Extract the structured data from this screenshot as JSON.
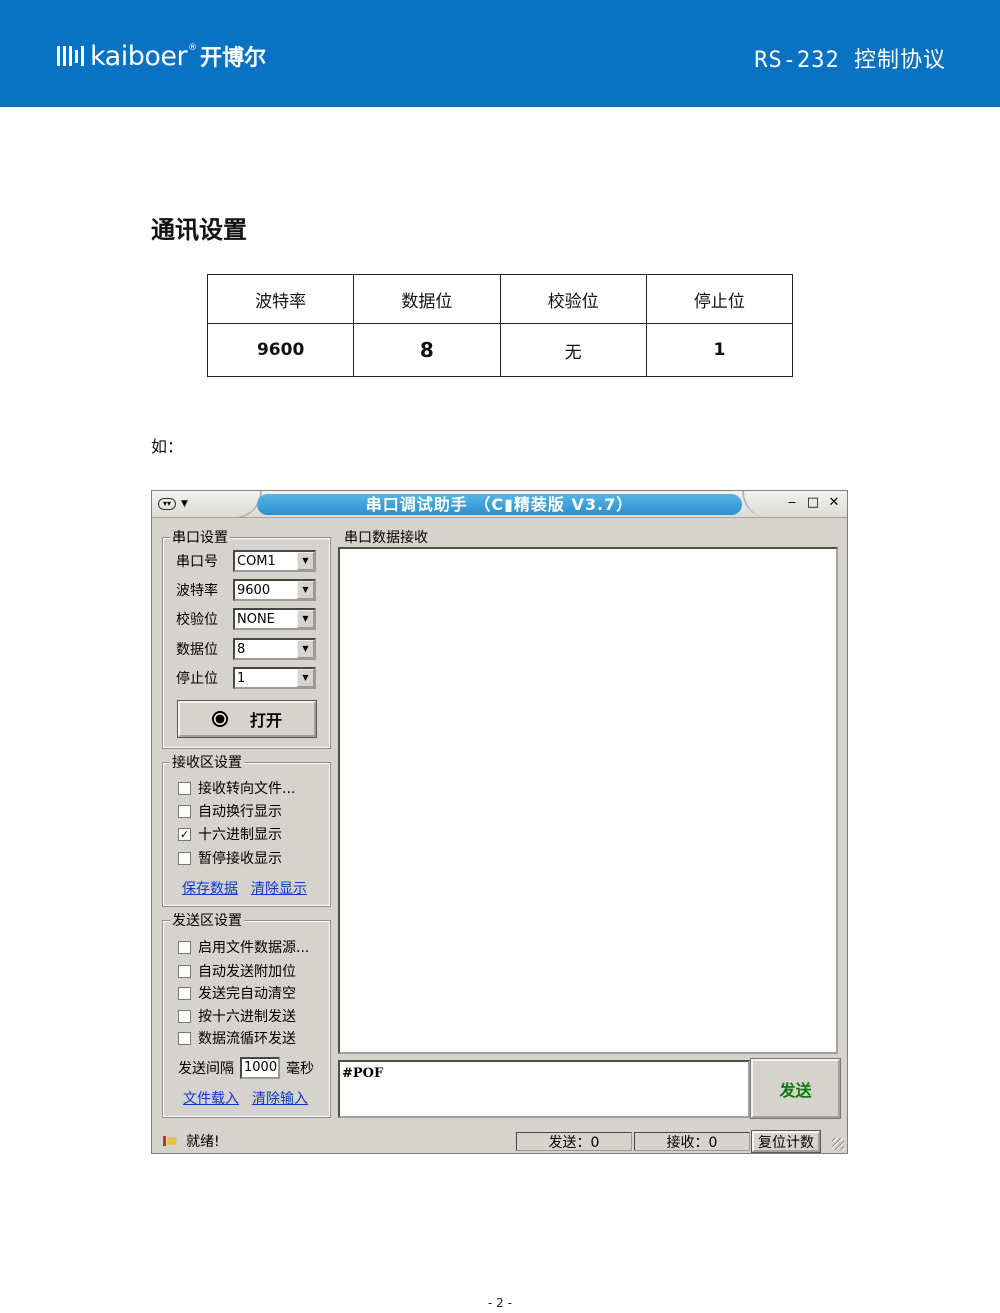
{
  "header": {
    "brand": "kaiboer",
    "brand_reg": "®",
    "brand_cn": "开博尔",
    "doc_title": "RS-232 控制协议",
    "colors": {
      "band": "#0a72c2"
    }
  },
  "section": {
    "title": "通讯设置"
  },
  "settings_table": {
    "headers": [
      "波特率",
      "数据位",
      "校验位",
      "停止位"
    ],
    "values": [
      "9600",
      "8",
      "无",
      "1"
    ]
  },
  "example_label": "如：",
  "app": {
    "title": "串口调试助手 （C▮精装版 V3.7）",
    "serial_group": {
      "title": "串口设置",
      "fields": [
        {
          "label": "串口号",
          "value": "COM1"
        },
        {
          "label": "波特率",
          "value": "9600"
        },
        {
          "label": "校验位",
          "value": "NONE"
        },
        {
          "label": "数据位",
          "value": "8"
        },
        {
          "label": "停止位",
          "value": "1"
        }
      ],
      "open_label": "打开"
    },
    "recv_group": {
      "title": "接收区设置",
      "options": [
        {
          "label": "接收转向文件...",
          "checked": false
        },
        {
          "label": "自动换行显示",
          "checked": false
        },
        {
          "label": "十六进制显示",
          "checked": true
        },
        {
          "label": "暂停接收显示",
          "checked": false
        }
      ],
      "save_link": "保存数据",
      "clear_link": "清除显示"
    },
    "send_group": {
      "title": "发送区设置",
      "options": [
        {
          "label": "启用文件数据源...",
          "checked": false
        },
        {
          "label": "自动发送附加位",
          "checked": false
        },
        {
          "label": "发送完自动清空",
          "checked": false
        },
        {
          "label": "按十六进制发送",
          "checked": false
        },
        {
          "label": "数据流循环发送",
          "checked": false
        }
      ],
      "interval_label": "发送间隔",
      "interval_value": "1000",
      "interval_unit": "毫秒",
      "load_link": "文件载入",
      "clear_input_link": "清除输入"
    },
    "recv_panel_title": "串口数据接收",
    "send_text": "#POF",
    "send_button": "发送",
    "status": {
      "ready": "就绪!",
      "sent": "发送：0",
      "received": "接收：0",
      "reset": "复位计数"
    }
  },
  "page_number": "- 2 -"
}
